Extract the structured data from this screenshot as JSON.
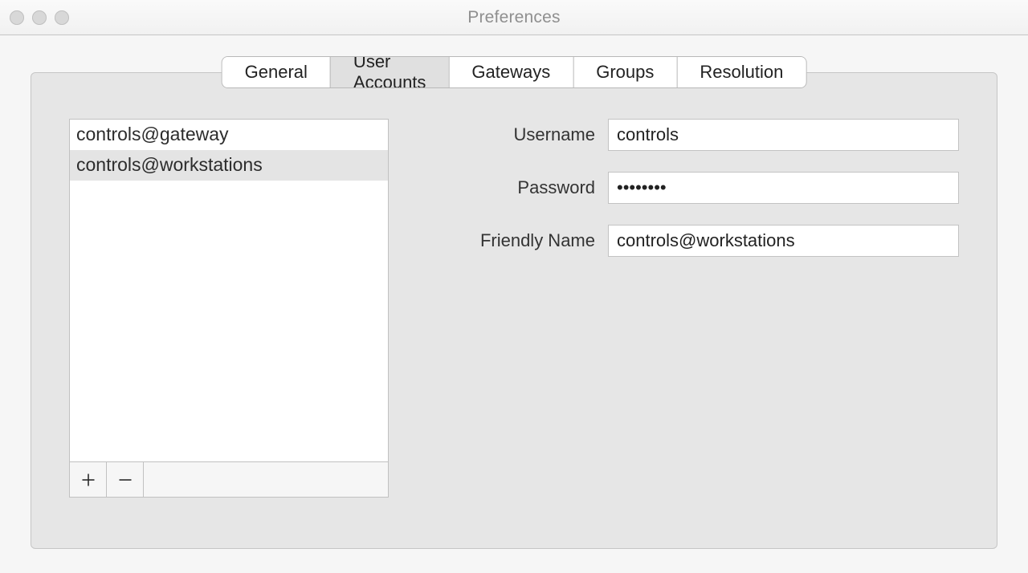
{
  "window": {
    "title": "Preferences"
  },
  "tabs": [
    {
      "label": "General",
      "active": false
    },
    {
      "label": "User Accounts",
      "active": true
    },
    {
      "label": "Gateways",
      "active": false
    },
    {
      "label": "Groups",
      "active": false
    },
    {
      "label": "Resolution",
      "active": false
    }
  ],
  "accounts": {
    "items": [
      {
        "label": "controls@gateway",
        "selected": false
      },
      {
        "label": "controls@workstations",
        "selected": true
      }
    ],
    "add_tooltip": "Add account",
    "remove_tooltip": "Remove account"
  },
  "form": {
    "username_label": "Username",
    "username_value": "controls",
    "password_label": "Password",
    "password_value": "••••••••",
    "friendly_label": "Friendly Name",
    "friendly_value": "controls@workstations"
  }
}
